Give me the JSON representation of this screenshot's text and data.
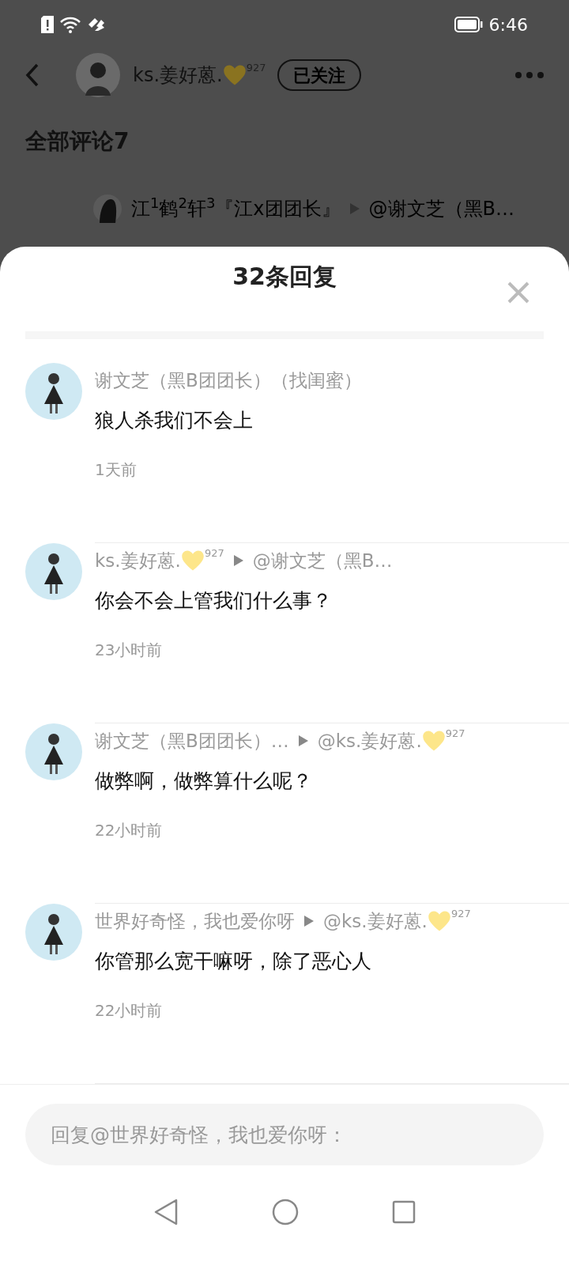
{
  "status_bar": {
    "time": "6:46"
  },
  "header": {
    "username": "ks.姜好蒽.",
    "badge": {
      "number": "927"
    },
    "follow_button": "已关注"
  },
  "section_title": "全部评论7",
  "partial_comment": {
    "author": "江$^{1}$鹤$^{2}$轩$^{3}$『江x团团长』",
    "reply_to": "@谢文芝（黑B…"
  },
  "sheet": {
    "title": "32条回复",
    "comments": [
      {
        "author": "谢文芝（黑B团团长）（找闺蜜）",
        "text": "狼人杀我们不会上",
        "time": "1天前"
      },
      {
        "author": "ks.姜好蒽.",
        "author_badge": {
          "number": "927"
        },
        "reply_to": "@谢文芝（黑B…",
        "text": "你会不会上管我们什么事？",
        "time": "23小时前"
      },
      {
        "author": "谢文芝（黑B团团长）…",
        "reply_to": "@ks.姜好蒽.",
        "reply_badge": {
          "number": "927"
        },
        "text": "做弊啊，做弊算什么呢？",
        "time": "22小时前"
      },
      {
        "author": "世界好奇怪，我也爱你呀",
        "reply_to": "@ks.姜好蒽.",
        "reply_badge": {
          "number": "927"
        },
        "text": "你管那么宽干嘛呀，除了恶心人",
        "time": "22小时前"
      }
    ],
    "reply_field": {
      "placeholder": "回复@世界好奇怪，我也爱你呀："
    }
  }
}
